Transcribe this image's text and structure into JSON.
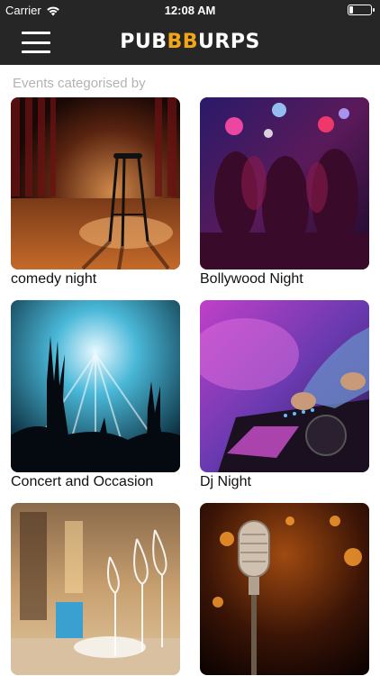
{
  "status_bar": {
    "carrier": "Carrier",
    "time": "12:08 AM"
  },
  "header": {
    "logo_part1": "PUB",
    "logo_accent": "BB",
    "logo_part2": "URPS",
    "accent_color": "#f2a516",
    "menu_icon": "hamburger-menu-icon"
  },
  "main": {
    "section_title": "Events categorised by",
    "categories": [
      {
        "label": "comedy night"
      },
      {
        "label": "Bollywood Night"
      },
      {
        "label": "Concert and Occasion"
      },
      {
        "label": "Dj Night"
      },
      {
        "label": ""
      },
      {
        "label": ""
      }
    ]
  }
}
